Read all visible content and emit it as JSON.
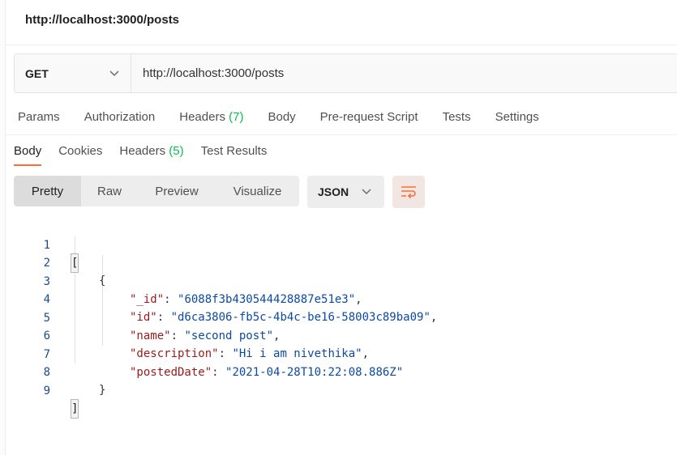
{
  "request": {
    "title": "http://localhost:3000/posts",
    "method": "GET",
    "url": "http://localhost:3000/posts"
  },
  "request_tabs": [
    {
      "label": "Params"
    },
    {
      "label": "Authorization"
    },
    {
      "label": "Headers",
      "count": "(7)"
    },
    {
      "label": "Body"
    },
    {
      "label": "Pre-request Script"
    },
    {
      "label": "Tests"
    },
    {
      "label": "Settings"
    }
  ],
  "response_tabs": [
    {
      "label": "Body",
      "active": true
    },
    {
      "label": "Cookies"
    },
    {
      "label": "Headers",
      "count": "(5)"
    },
    {
      "label": "Test Results"
    }
  ],
  "view_modes": [
    "Pretty",
    "Raw",
    "Preview",
    "Visualize"
  ],
  "active_view": "Pretty",
  "format": "JSON",
  "icons": {
    "method_chevron": "chevron-down-icon",
    "format_chevron": "chevron-down-icon",
    "wrap": "wrap-lines-icon"
  },
  "colors": {
    "accent": "#ff6c37",
    "count_green": "#0cbb52",
    "json_key": "#9a1a1a",
    "json_string": "#0c4aa0"
  },
  "response_body": {
    "line_numbers": [
      "1",
      "2",
      "3",
      "4",
      "5",
      "6",
      "7",
      "8",
      "9"
    ],
    "open_array": "[",
    "open_object": "{",
    "fields": [
      {
        "key": "\"_id\"",
        "value": "\"6088f3b430544428887e51e3\"",
        "trail": ","
      },
      {
        "key": "\"id\"",
        "value": "\"d6ca3806-fb5c-4b4c-be16-58003c89ba09\"",
        "trail": ","
      },
      {
        "key": "\"name\"",
        "value": "\"second post\"",
        "trail": ","
      },
      {
        "key": "\"description\"",
        "value": "\"Hi i am nivethika\"",
        "trail": ","
      },
      {
        "key": "\"postedDate\"",
        "value": "\"2021-04-28T10:22:08.886Z\"",
        "trail": ""
      }
    ],
    "close_object": "}",
    "close_array": "]"
  }
}
